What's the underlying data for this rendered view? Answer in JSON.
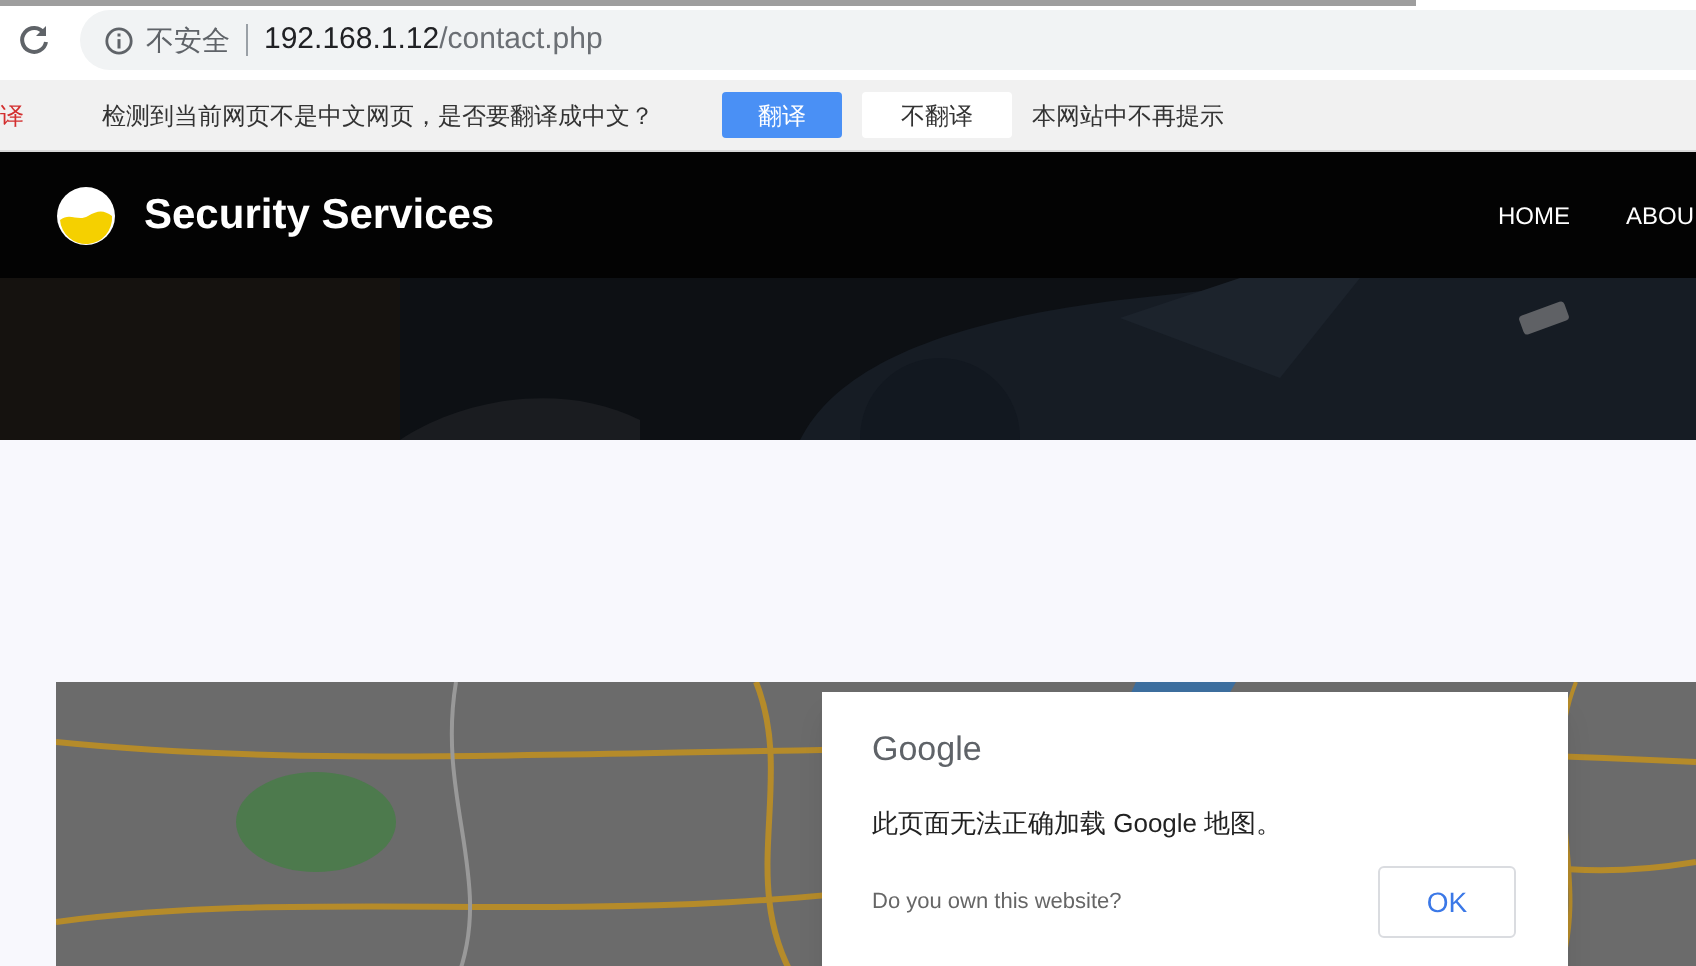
{
  "address_bar": {
    "security": "不安全",
    "host": "192.168.1.12",
    "path": "/contact.php"
  },
  "translate_bar": {
    "cut_label": "译",
    "message": "检测到当前网页不是中文网页，是否要翻译成中文？",
    "buttons": [
      {
        "label": "翻译",
        "kind": "primary"
      },
      {
        "label": "不翻译",
        "kind": "secondary"
      },
      {
        "label": "本网站中不再提示",
        "kind": "link"
      }
    ]
  },
  "header": {
    "brand": "Security Services",
    "nav": [
      {
        "label": "HOME"
      },
      {
        "label": "ABOU"
      }
    ]
  },
  "map": {
    "kind": "picture",
    "dialog": {
      "logo": "Google",
      "message": "此页面无法正确加载 Google 地图。",
      "question": "Do you own this website?",
      "button": "OK"
    }
  }
}
